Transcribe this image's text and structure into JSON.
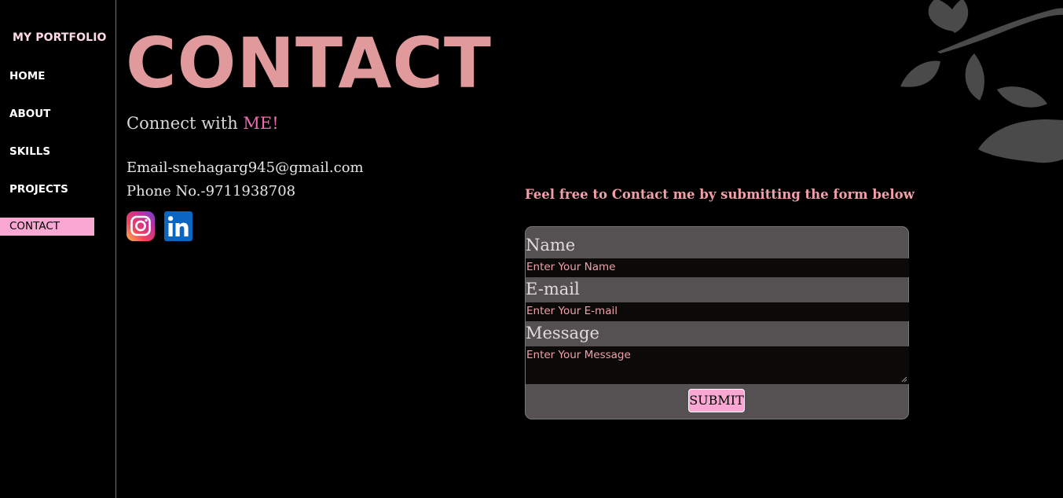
{
  "sidebar": {
    "brand": "MY PORTFOLIO",
    "items": [
      {
        "label": "HOME",
        "active": false
      },
      {
        "label": "ABOUT",
        "active": false
      },
      {
        "label": "SKILLS",
        "active": false
      },
      {
        "label": "PROJECTS",
        "active": false
      },
      {
        "label": "CONTACT",
        "active": true
      }
    ]
  },
  "main": {
    "title": "CONTACT",
    "connect_prefix": "Connect with ",
    "connect_accent": "ME!",
    "email": "Email-snehagarg945@gmail.com",
    "phone": "Phone No.-9711938708",
    "social": [
      {
        "name": "instagram-icon"
      },
      {
        "name": "linkedin-icon"
      }
    ]
  },
  "form": {
    "intro": "Feel free to Contact me by submitting the form below",
    "name_label": "Name",
    "name_placeholder": "Enter Your Name",
    "email_label": "E-mail",
    "email_placeholder": "Enter Your E-mail",
    "message_label": "Message",
    "message_placeholder": "Enter Your Message",
    "submit_label": "SUBMIT"
  },
  "colors": {
    "background": "#000000",
    "accent_pink": "#f9a8d4",
    "title_pink": "#e09a9c",
    "highlight_pink": "#f06bb0",
    "form_card": "#555152",
    "input_bg": "#0c0909"
  },
  "decoration": {
    "icon": "leaf-branch-icon"
  }
}
